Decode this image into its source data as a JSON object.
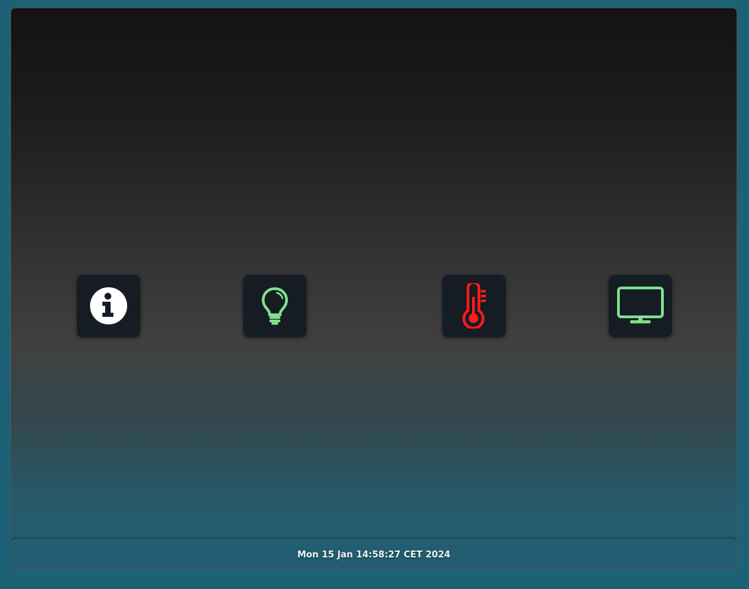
{
  "tiles": [
    {
      "id": "info",
      "icon": "info-icon",
      "color": "#ffffff"
    },
    {
      "id": "light",
      "icon": "lightbulb-icon",
      "color": "#7ee08a"
    },
    {
      "id": "temperature",
      "icon": "thermometer-icon",
      "color": "#ff1a1a"
    },
    {
      "id": "tv",
      "icon": "tv-monitor-icon",
      "color": "#7ee08a"
    }
  ],
  "status_bar": {
    "datetime": "Mon 15 Jan 14:58:27 CET 2024"
  },
  "colors": {
    "tile_bg": "#161c24",
    "accent_green": "#7ee08a",
    "accent_red": "#ff1a1a",
    "status_bg": "#225d71"
  }
}
